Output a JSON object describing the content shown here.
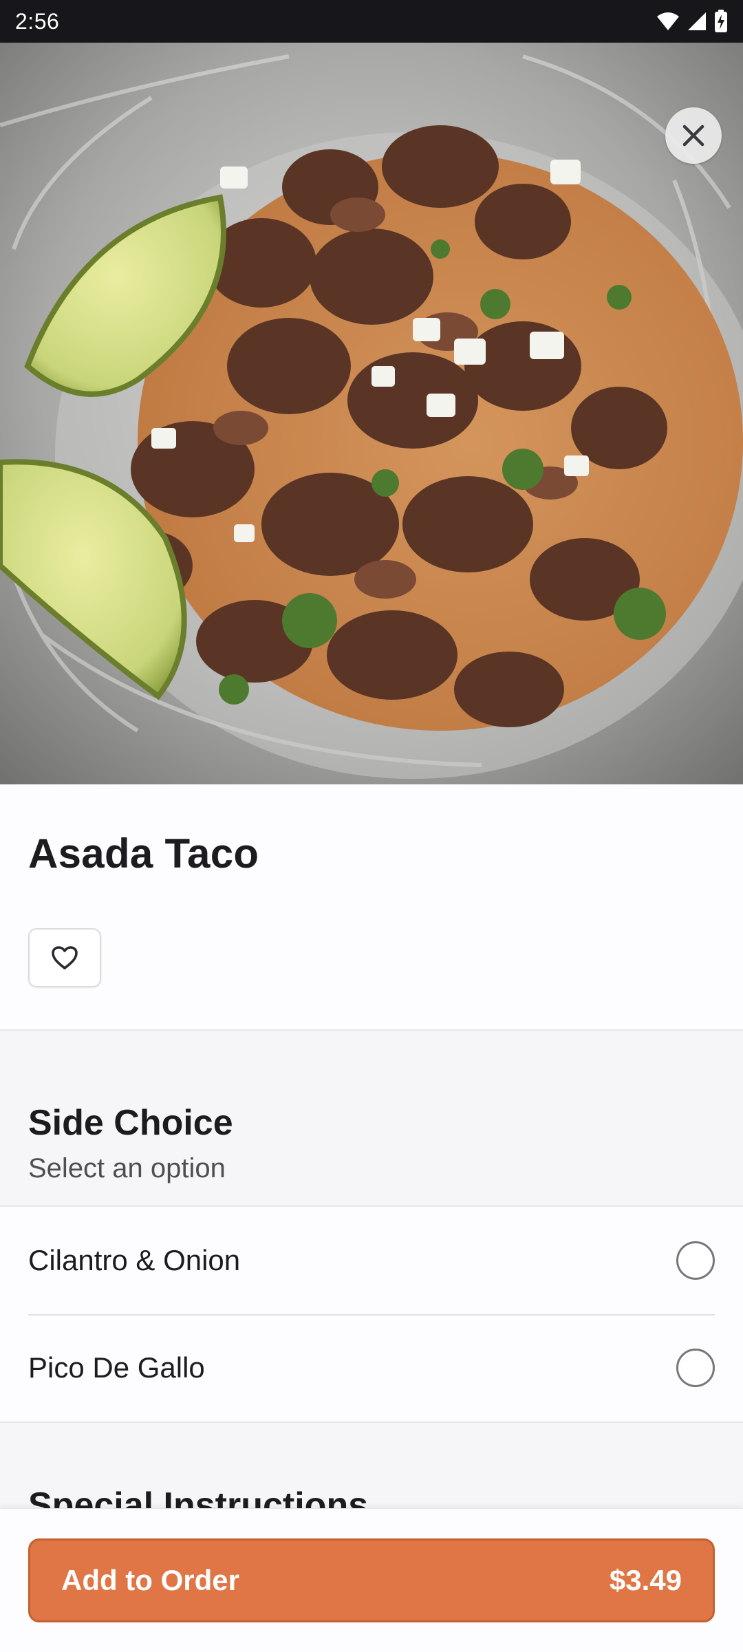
{
  "status_bar": {
    "time": "2:56",
    "icons": [
      "wifi-icon",
      "cellular-signal-icon",
      "battery-charging-icon"
    ]
  },
  "hero": {
    "image": "photo of asada taco with lime wedges, onion and cilantro",
    "close_icon": "close-icon"
  },
  "product": {
    "title": "Asada Taco",
    "favorite_icon": "heart-outline-icon"
  },
  "side_choice": {
    "title": "Side Choice",
    "subtitle": "Select an option",
    "options": [
      {
        "label": "Cilantro & Onion",
        "selected": false
      },
      {
        "label": "Pico De Gallo",
        "selected": false
      }
    ]
  },
  "next_section": {
    "title": "Special Instructions"
  },
  "order": {
    "button_label": "Add to Order",
    "price": "$3.49",
    "accent_color": "#e07646"
  }
}
